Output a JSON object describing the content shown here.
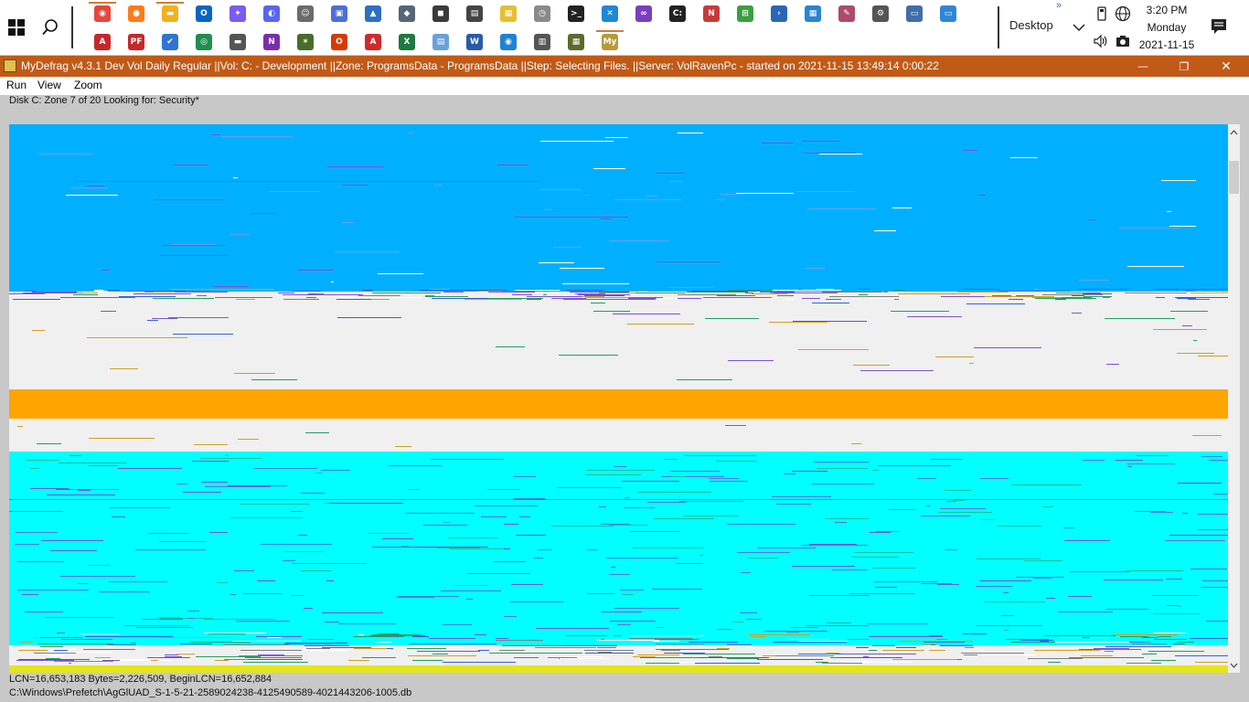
{
  "taskbar": {
    "desktop_label": "Desktop",
    "overflow_label": "»",
    "clock": {
      "time": "3:20 PM",
      "day": "Monday",
      "date": "2021-11-15"
    },
    "row1_icons": [
      {
        "name": "chrome-icon",
        "color": "#e8453c",
        "glyph": "◉"
      },
      {
        "name": "firefox-icon",
        "color": "#ff7b1a",
        "glyph": "●"
      },
      {
        "name": "file-explorer-icon",
        "color": "#f2b01e",
        "glyph": "▬"
      },
      {
        "name": "outlook-icon",
        "color": "#0a64c8",
        "glyph": "O"
      },
      {
        "name": "messenger-icon",
        "color": "#7b5cf2",
        "glyph": "✦"
      },
      {
        "name": "discord-icon",
        "color": "#5865f2",
        "glyph": "◐"
      },
      {
        "name": "gimp-icon",
        "color": "#6b6b6b",
        "glyph": "☺"
      },
      {
        "name": "paint-icon",
        "color": "#4a6fdc",
        "glyph": "▣"
      },
      {
        "name": "photos-icon",
        "color": "#2d6fc2",
        "glyph": "▲"
      },
      {
        "name": "tool-icon",
        "color": "#556677",
        "glyph": "◆"
      },
      {
        "name": "camera-icon",
        "color": "#3b3b3b",
        "glyph": "◼"
      },
      {
        "name": "printer-icon",
        "color": "#444444",
        "glyph": "▤"
      },
      {
        "name": "notes-icon",
        "color": "#e3c02f",
        "glyph": "▦"
      },
      {
        "name": "clock-app-icon",
        "color": "#8a8a8a",
        "glyph": "◷"
      },
      {
        "name": "terminal-icon",
        "color": "#222222",
        "glyph": ">_"
      },
      {
        "name": "vscode-icon",
        "color": "#1e88d6",
        "glyph": "✕"
      },
      {
        "name": "visual-studio-icon",
        "color": "#7a3fbf",
        "glyph": "∞"
      },
      {
        "name": "cmd-icon",
        "color": "#222222",
        "glyph": "C:"
      },
      {
        "name": "git-icon",
        "color": "#c83a3a",
        "glyph": "N"
      },
      {
        "name": "windows-icon",
        "color": "#38a040",
        "glyph": "⊞"
      },
      {
        "name": "powershell-icon",
        "color": "#2a66b8",
        "glyph": "›"
      },
      {
        "name": "grid-app-icon",
        "color": "#2a84d2",
        "glyph": "▦"
      },
      {
        "name": "settings-app-icon",
        "color": "#b04a6a",
        "glyph": "✎"
      },
      {
        "name": "gear-icon",
        "color": "#555555",
        "glyph": "⚙"
      },
      {
        "name": "monitor-icon",
        "color": "#3f6ea8",
        "glyph": "▭"
      },
      {
        "name": "remote-desktop-icon",
        "color": "#2f86d8",
        "glyph": "▭"
      }
    ],
    "row2_icons": [
      {
        "name": "acrobat-icon",
        "color": "#c62828",
        "glyph": "A"
      },
      {
        "name": "pdf-icon",
        "color": "#c62828",
        "glyph": "PF"
      },
      {
        "name": "todo-icon",
        "color": "#2f73d6",
        "glyph": "✔"
      },
      {
        "name": "green-app-icon",
        "color": "#1f8f50",
        "glyph": "◎"
      },
      {
        "name": "scanner-icon",
        "color": "#555555",
        "glyph": "▬"
      },
      {
        "name": "onenote-icon",
        "color": "#7a2fa8",
        "glyph": "N"
      },
      {
        "name": "palm-icon",
        "color": "#4a6b2a",
        "glyph": "✶"
      },
      {
        "name": "office-icon",
        "color": "#d83b01",
        "glyph": "O"
      },
      {
        "name": "adobe-reader-icon",
        "color": "#d12a2a",
        "glyph": "A"
      },
      {
        "name": "excel-icon",
        "color": "#1d7a3f",
        "glyph": "X"
      },
      {
        "name": "notepad-icon",
        "color": "#6aa2d8",
        "glyph": "▤"
      },
      {
        "name": "word-icon",
        "color": "#2a5ba8",
        "glyph": "W"
      },
      {
        "name": "browser-icon",
        "color": "#1e82d6",
        "glyph": "◉"
      },
      {
        "name": "film-icon",
        "color": "#555555",
        "glyph": "▥"
      },
      {
        "name": "sheet-icon",
        "color": "#5a6b2a",
        "glyph": "▦"
      },
      {
        "name": "mydefrag-icon",
        "color": "#b89a3a",
        "glyph": "My"
      }
    ]
  },
  "window": {
    "title": "MyDefrag v4.3.1   Dev Vol Daily Regular ||Vol: C: - Development ||Zone: ProgramsData - ProgramsData ||Step: Selecting Files. ||Server: VolRavenPc -  started on 2021-11-15 13:49:14 0:00:22",
    "minimize": "—",
    "restore": "❐",
    "close": "✕"
  },
  "menu": {
    "items": [
      "Run",
      "View",
      "Zoom"
    ]
  },
  "info": {
    "text": "Disk C:   Zone 7 of 20   Looking for: Security*"
  },
  "status": {
    "line1": "LCN=16,653,183     Bytes=2,226,509, BeginLCN=16,652,884",
    "line2": "C:\\Windows\\Prefetch\\AgGlUAD_S-1-5-21-2589024238-4125490589-4021443206-1005.db"
  },
  "colors": {
    "blue_zone": "#00b0ff",
    "cyan_zone": "#00ffff",
    "free_space": "#f0f0f0",
    "orange_band": "#ffa500",
    "yellow_band": "#e5e51a",
    "fragment_purple": "#7b53d6",
    "title_bar": "#c15a17"
  }
}
